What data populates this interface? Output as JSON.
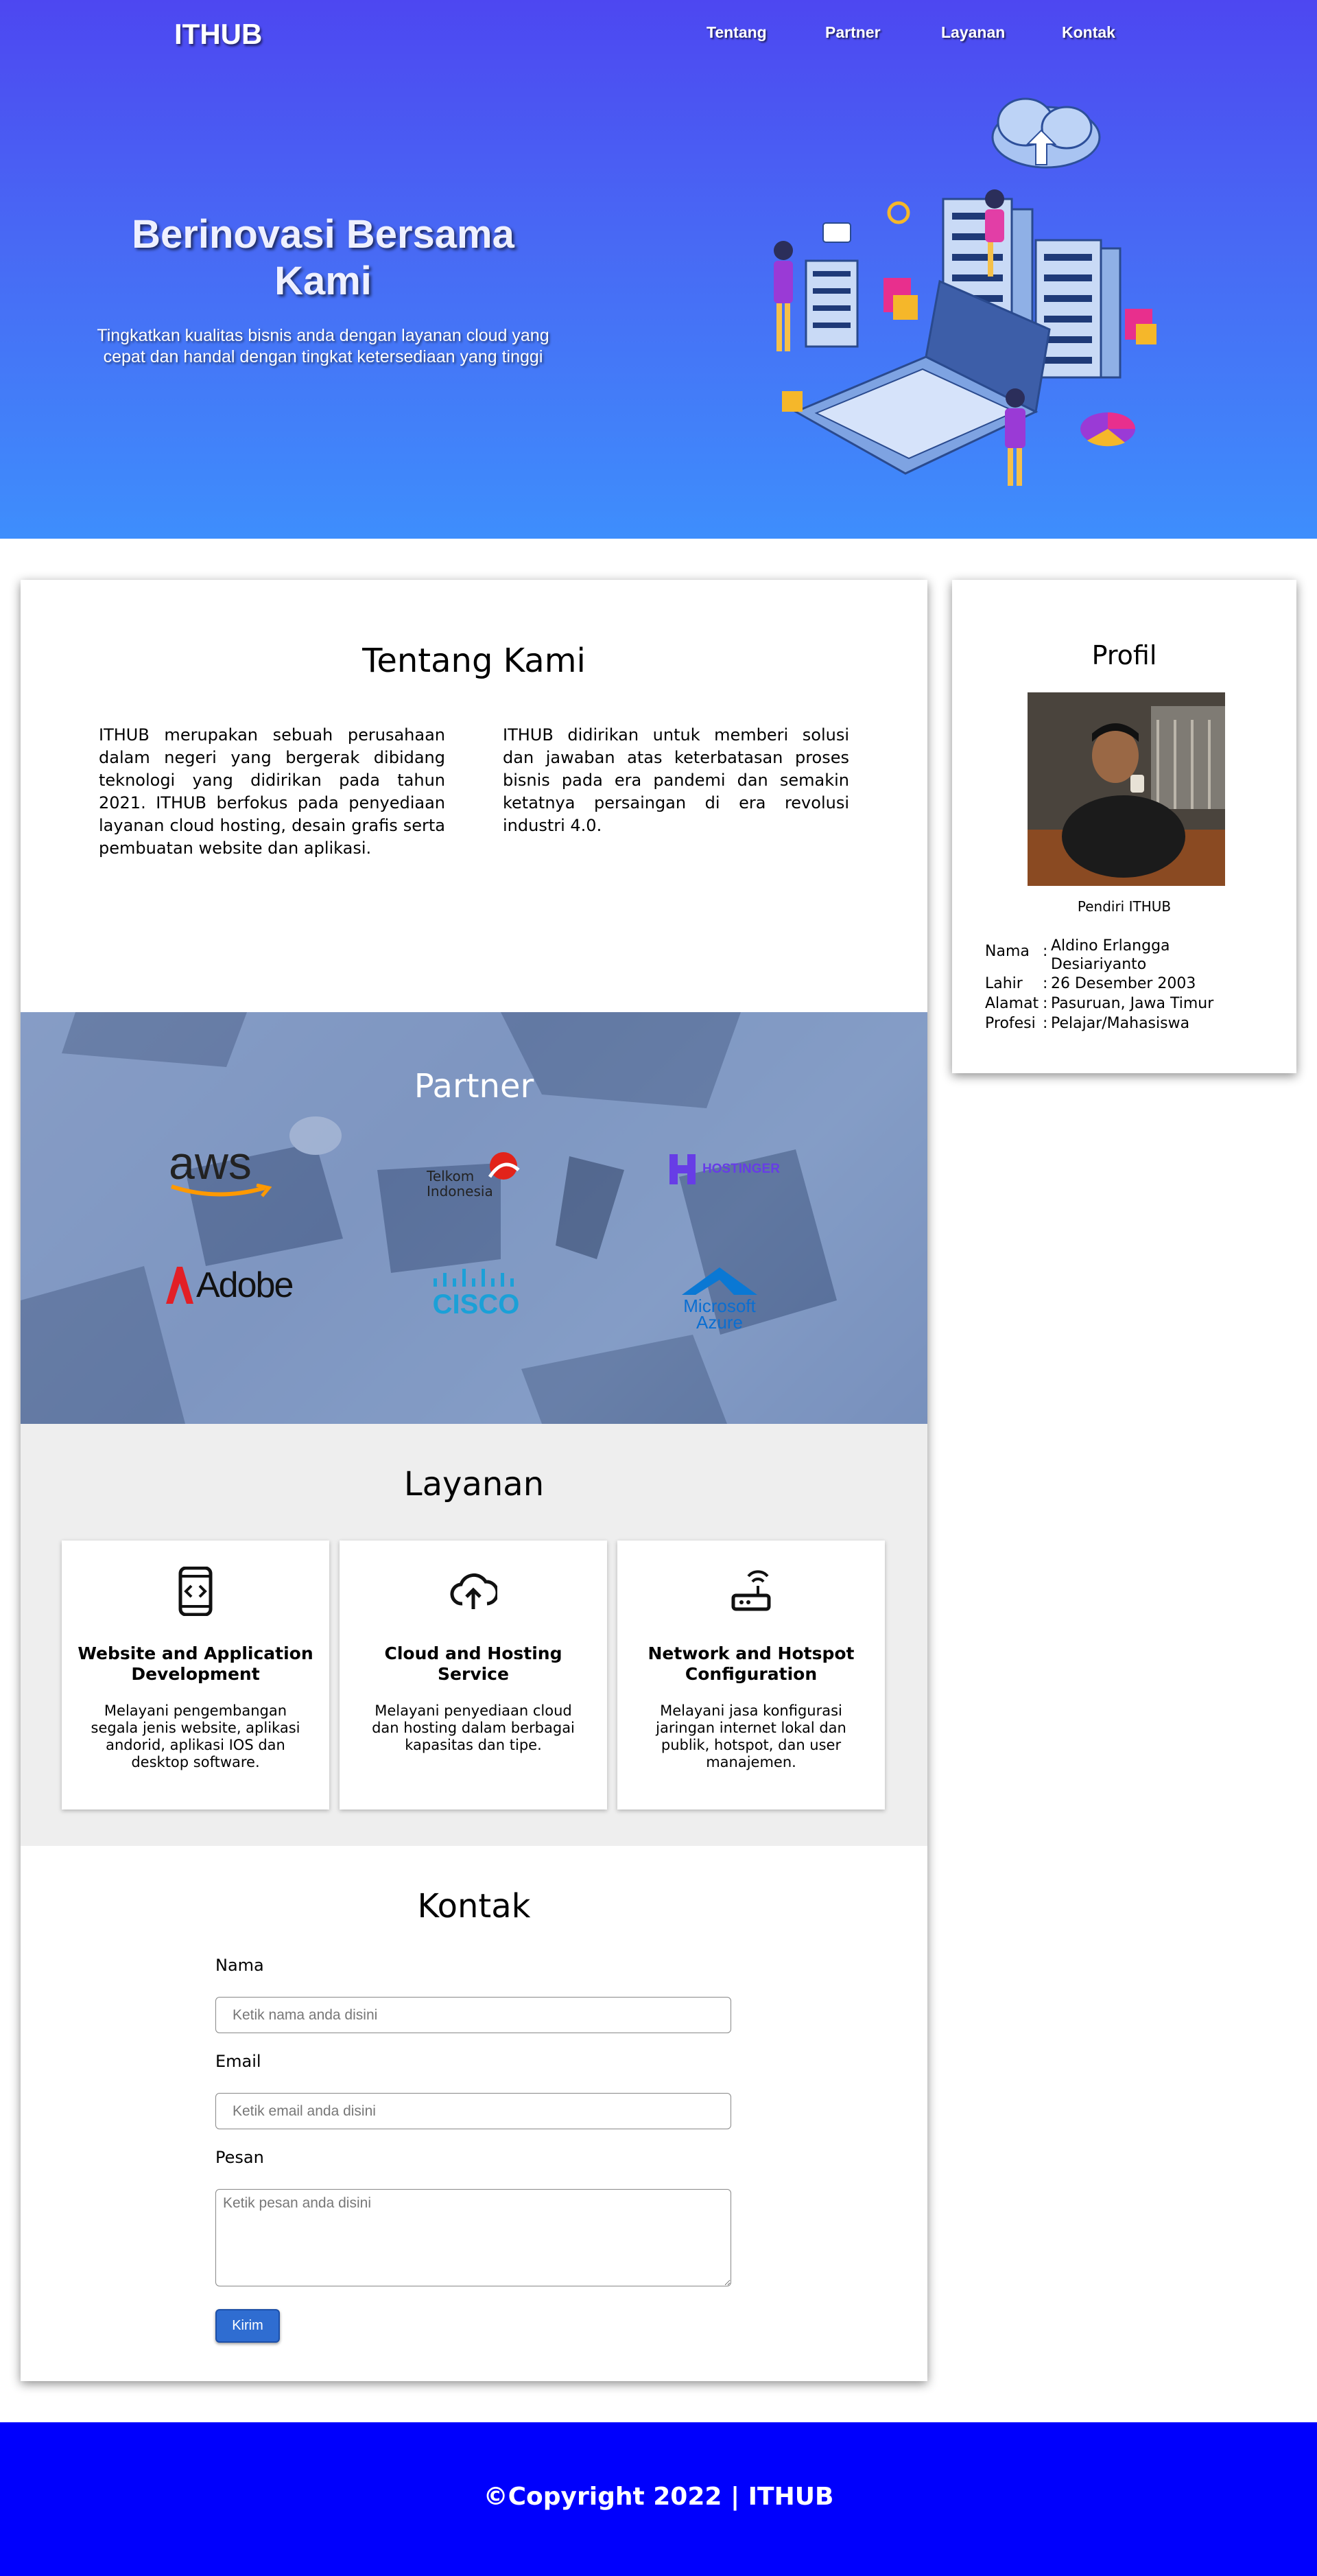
{
  "header": {
    "logo": "ITHUB",
    "nav": [
      "Tentang",
      "Partner",
      "Layanan",
      "Kontak"
    ]
  },
  "hero": {
    "title": "Berinovasi Bersama Kami",
    "subtitle": "Tingkatkan kualitas bisnis anda dengan layanan cloud yang cepat dan handal dengan tingkat ketersediaan yang tinggi"
  },
  "about": {
    "title": "Tentang Kami",
    "col1": "ITHUB merupakan sebuah perusahaan dalam negeri yang bergerak dibidang teknologi yang didirikan pada tahun 2021. ITHUB berfokus pada penyediaan layanan cloud hosting, desain grafis serta pembuatan website dan aplikasi.",
    "col2": "ITHUB didirikan untuk memberi solusi dan jawaban atas keterbatasan proses bisnis pada era pandemi dan semakin ketatnya persaingan di era revolusi industri 4.0."
  },
  "partner": {
    "title": "Partner",
    "logos": {
      "aws": "aws",
      "telkom": "Telkom Indonesia",
      "hostinger": "HOSTINGER",
      "adobe": "Adobe",
      "cisco": "CISCO",
      "azure_line1": "Microsoft",
      "azure_line2": "Azure"
    }
  },
  "services": {
    "title": "Layanan",
    "items": [
      {
        "title": "Website and Application Development",
        "desc": "Melayani pengembangan segala jenis website, aplikasi andorid, aplikasi IOS dan desktop software.",
        "icon": "mobile-code-icon"
      },
      {
        "title": "Cloud and Hosting Service",
        "desc": "Melayani penyediaan cloud dan hosting dalam berbagai kapasitas dan tipe.",
        "icon": "cloud-upload-icon"
      },
      {
        "title": "Network and Hotspot Configuration",
        "desc": "Melayani jasa konfigurasi jaringan internet lokal dan publik, hotspot, dan user manajemen.",
        "icon": "router-icon"
      }
    ]
  },
  "contact": {
    "title": "Kontak",
    "name_label": "Nama",
    "name_placeholder": "Ketik nama anda disini",
    "email_label": "Email",
    "email_placeholder": "Ketik email anda disini",
    "message_label": "Pesan",
    "message_placeholder": "Ketik pesan anda disini",
    "submit": "Kirim"
  },
  "profile": {
    "title": "Profil",
    "caption": "Pendiri ITHUB",
    "rows": [
      {
        "key": "Nama",
        "sep": ":",
        "value": "Aldino Erlangga Desiariyanto"
      },
      {
        "key": "Lahir",
        "sep": ":",
        "value": "26 Desember 2003"
      },
      {
        "key": "Alamat",
        "sep": ":",
        "value": "Pasuruan, Jawa Timur"
      },
      {
        "key": "Profesi",
        "sep": ":",
        "value": "Pelajar/Mahasiswa"
      }
    ]
  },
  "footer": {
    "copyright": "©Copyright 2022 | ITHUB"
  },
  "colors": {
    "hero_top": "#4d47f1",
    "hero_bottom": "#3e8efc",
    "footer": "#0000fd",
    "button": "#2f6dd1"
  }
}
